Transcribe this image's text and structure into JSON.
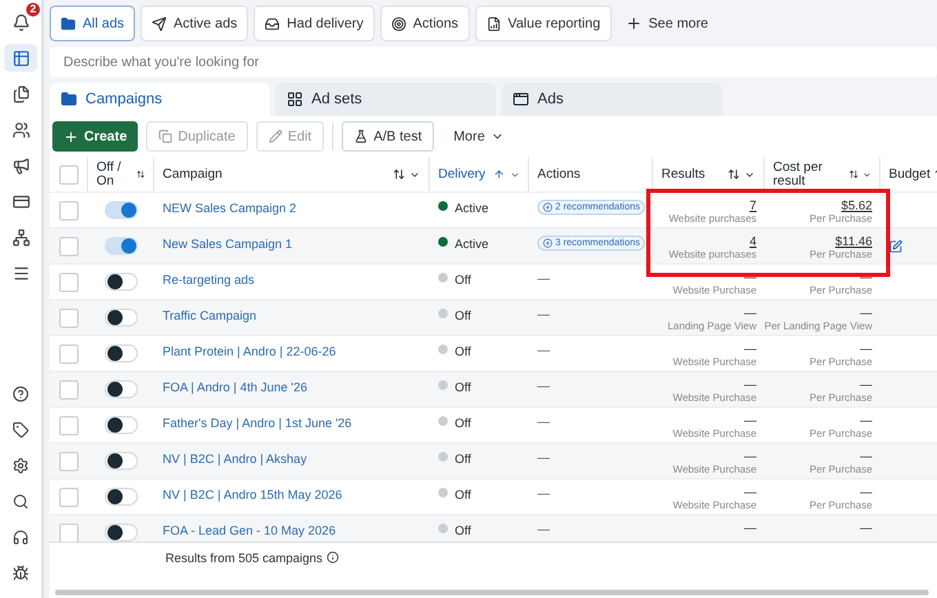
{
  "sidebar": {
    "alert_badge": "2",
    "items": [
      {
        "kind": "alerts",
        "selected": false
      },
      {
        "kind": "table",
        "selected": true
      },
      {
        "kind": "pages",
        "selected": false
      },
      {
        "kind": "people",
        "selected": false
      },
      {
        "kind": "megaphone",
        "selected": false
      },
      {
        "kind": "card",
        "selected": false
      },
      {
        "kind": "network",
        "selected": false
      },
      {
        "kind": "menu",
        "selected": false
      }
    ],
    "bottom_items": [
      {
        "kind": "help"
      },
      {
        "kind": "tag"
      },
      {
        "kind": "settings"
      },
      {
        "kind": "search"
      },
      {
        "kind": "headset"
      },
      {
        "kind": "bug"
      }
    ]
  },
  "filters": [
    {
      "label": "All ads",
      "kind": "folder",
      "selected": true
    },
    {
      "label": "Active ads",
      "kind": "send",
      "selected": false
    },
    {
      "label": "Had delivery",
      "kind": "inbox",
      "selected": false
    },
    {
      "label": "Actions",
      "kind": "target",
      "selected": false
    },
    {
      "label": "Value reporting",
      "kind": "report",
      "selected": false
    }
  ],
  "see_more": "See more",
  "search": {
    "placeholder": "Describe what you're looking for"
  },
  "tabs": [
    {
      "label": "Campaigns",
      "kind": "folder",
      "selected": true
    },
    {
      "label": "Ad sets",
      "kind": "grid",
      "selected": false
    },
    {
      "label": "Ads",
      "kind": "window",
      "selected": false
    }
  ],
  "toolbar": {
    "create": "Create",
    "duplicate": "Duplicate",
    "edit": "Edit",
    "ab_test": "A/B test",
    "more": "More"
  },
  "table": {
    "select_all_checked": false,
    "columns": [
      {
        "label": "Off / On",
        "sort": true,
        "menu": false,
        "selected": false
      },
      {
        "label": "Campaign",
        "sort": true,
        "menu": true,
        "selected": false
      },
      {
        "label": "Delivery",
        "sort": true,
        "menu": true,
        "selected": true
      },
      {
        "label": "Actions",
        "sort": false,
        "menu": false,
        "selected": false
      },
      {
        "label": "Results",
        "sort": true,
        "menu": true,
        "selected": false
      },
      {
        "label": "Cost per result",
        "sort": true,
        "menu": true,
        "selected": false
      },
      {
        "label": "Budget",
        "sort": true,
        "selected": false
      }
    ],
    "rows": [
      {
        "checked": false,
        "on": true,
        "name": "NEW Sales Campaign 2",
        "active": true,
        "delivery": "Active",
        "action": {
          "kind": "recommendations",
          "text": "2 recommendations"
        },
        "result": "7",
        "result_label": "Website purchases",
        "cost": "$5.62",
        "cost_label": "Per Purchase",
        "budget_icon": false
      },
      {
        "checked": false,
        "on": true,
        "name": "New Sales Campaign 1",
        "active": true,
        "delivery": "Active",
        "action": {
          "kind": "recommendations",
          "text": "3 recommendations"
        },
        "result": "4",
        "result_label": "Website purchases",
        "cost": "$11.46",
        "cost_label": "Per Purchase",
        "budget_icon": true
      },
      {
        "checked": false,
        "on": false,
        "name": "Re-targeting ads",
        "active": false,
        "delivery": "Off",
        "action": {
          "kind": "none",
          "text": "—"
        },
        "result": "—",
        "result_label": "Website Purchase",
        "cost": "—",
        "cost_label": "Per Purchase",
        "budget_icon": false
      },
      {
        "checked": false,
        "on": false,
        "name": "Traffic Campaign",
        "active": false,
        "delivery": "Off",
        "action": {
          "kind": "none",
          "text": "—"
        },
        "result": "—",
        "result_label": "Landing Page View",
        "cost": "—",
        "cost_label": "Per Landing Page View",
        "budget_icon": false
      },
      {
        "checked": false,
        "on": false,
        "name": "Plant Protein | Andro | 22-06-26",
        "active": false,
        "delivery": "Off",
        "action": {
          "kind": "none",
          "text": "—"
        },
        "result": "—",
        "result_label": "Website Purchase",
        "cost": "—",
        "cost_label": "Per Purchase",
        "budget_icon": false
      },
      {
        "checked": false,
        "on": false,
        "name": "FOA | Andro | 4th June '26",
        "active": false,
        "delivery": "Off",
        "action": {
          "kind": "none",
          "text": "—"
        },
        "result": "—",
        "result_label": "Website Purchase",
        "cost": "—",
        "cost_label": "Per Purchase",
        "budget_icon": false
      },
      {
        "checked": false,
        "on": false,
        "name": "Father's Day | Andro | 1st June '26",
        "active": false,
        "delivery": "Off",
        "action": {
          "kind": "none",
          "text": "—"
        },
        "result": "—",
        "result_label": "Website Purchase",
        "cost": "—",
        "cost_label": "Per Purchase",
        "budget_icon": false
      },
      {
        "checked": false,
        "on": false,
        "name": "NV | B2C | Andro | Akshay",
        "active": false,
        "delivery": "Off",
        "action": {
          "kind": "none",
          "text": "—"
        },
        "result": "—",
        "result_label": "Website Purchase",
        "cost": "—",
        "cost_label": "Per Purchase",
        "budget_icon": false
      },
      {
        "checked": false,
        "on": false,
        "name": "NV | B2C | Andro 15th May 2026",
        "active": false,
        "delivery": "Off",
        "action": {
          "kind": "none",
          "text": "—"
        },
        "result": "—",
        "result_label": "Website Purchase",
        "cost": "—",
        "cost_label": "Per Purchase",
        "budget_icon": false
      },
      {
        "checked": false,
        "on": false,
        "name": "FOA - Lead Gen - 10 May 2026",
        "active": false,
        "delivery": "Off",
        "action": {
          "kind": "none",
          "text": "—"
        },
        "result": "—",
        "cost": "—",
        "budget_icon": false
      }
    ],
    "footer": "Results from 505 campaigns"
  },
  "highlight": {
    "shown": true
  }
}
